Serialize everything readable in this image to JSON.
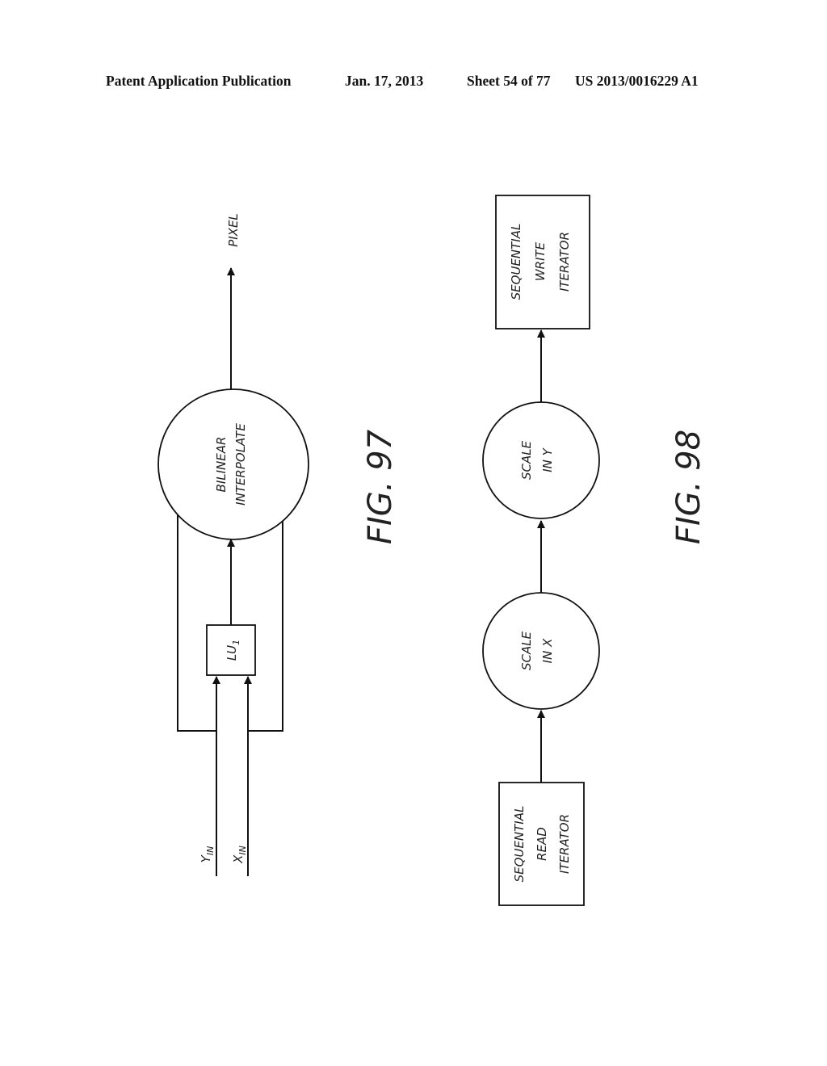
{
  "header": {
    "publication": "Patent Application Publication",
    "date": "Jan. 17, 2013",
    "sheet": "Sheet 54 of 77",
    "number": "US 2013/0016229 A1"
  },
  "fig97": {
    "caption": "FIG. 97",
    "output_label": "PIXEL",
    "interpolate_node": {
      "line1": "BILINEAR",
      "line2": "INTERPOLATE"
    },
    "lookup_node": {
      "main": "LU",
      "sub": "1"
    },
    "inputs": [
      {
        "main": "Y",
        "sub": "IN"
      },
      {
        "main": "X",
        "sub": "IN"
      }
    ]
  },
  "fig98": {
    "caption": "FIG. 98",
    "nodes": [
      {
        "lines": [
          "SEQUENTIAL",
          "READ",
          "ITERATOR"
        ]
      },
      {
        "lines": [
          "SCALE",
          "IN X"
        ]
      },
      {
        "lines": [
          "SCALE",
          "IN Y"
        ]
      },
      {
        "lines": [
          "SEQUENTIAL",
          "WRITE",
          "ITERATOR"
        ]
      }
    ]
  }
}
